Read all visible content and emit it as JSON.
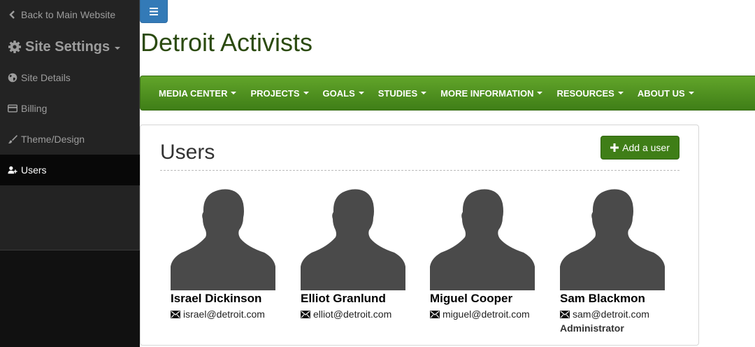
{
  "sidebar": {
    "back_link": "Back to Main Website",
    "section_title": "Site Settings",
    "items": [
      {
        "label": "Site Details",
        "icon": "globe-icon"
      },
      {
        "label": "Billing",
        "icon": "credit-card-icon"
      },
      {
        "label": "Theme/Design",
        "icon": "brush-icon"
      },
      {
        "label": "Users",
        "icon": "add-user-icon",
        "active": true
      }
    ]
  },
  "header": {
    "site_title": "Detroit Activists",
    "toggle_icon": "hamburger-menu-icon"
  },
  "navbar": {
    "items": [
      {
        "label": "MEDIA CENTER"
      },
      {
        "label": "PROJECTS"
      },
      {
        "label": "GOALS"
      },
      {
        "label": "STUDIES"
      },
      {
        "label": "MORE INFORMATION"
      },
      {
        "label": "RESOURCES"
      },
      {
        "label": "ABOUT US"
      }
    ]
  },
  "users_panel": {
    "title": "Users",
    "add_button_label": "Add a user",
    "users": [
      {
        "name": "Israel Dickinson",
        "email": "israel@detroit.com",
        "role": ""
      },
      {
        "name": "Elliot Granlund",
        "email": "elliot@detroit.com",
        "role": ""
      },
      {
        "name": "Miguel Cooper",
        "email": "miguel@detroit.com",
        "role": ""
      },
      {
        "name": "Sam Blackmon",
        "email": "sam@detroit.com",
        "role": "Administrator"
      }
    ]
  },
  "colors": {
    "sidebar_bg": "#232323",
    "sidebar_active_bg": "#080808",
    "toggle_blue": "#337ab7",
    "site_title_green": "#2b4a0f",
    "navbar_green": "#4f8f1f",
    "button_green": "#3f7e17",
    "avatar_gray": "#4a4a4a"
  }
}
